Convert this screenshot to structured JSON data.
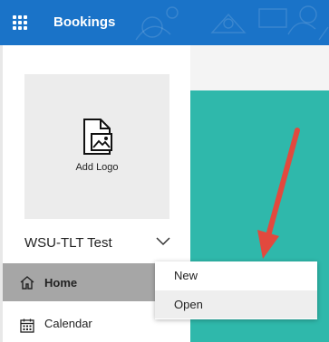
{
  "header": {
    "app_title": "Bookings",
    "menu_icon": "waffle-grid-icon",
    "accent": "#1a73c8"
  },
  "sidebar": {
    "logo": {
      "label": "Add Logo",
      "icon": "add-image-icon"
    },
    "business_name": "WSU-TLT Test",
    "toggle_icon": "chevron-down-icon",
    "nav": [
      {
        "label": "Home",
        "icon": "home-icon",
        "selected": true
      },
      {
        "label": "Calendar",
        "icon": "calendar-icon",
        "selected": false
      }
    ]
  },
  "dropdown": {
    "items": [
      {
        "label": "New",
        "highlighted": false
      },
      {
        "label": "Open",
        "highlighted": true
      }
    ]
  },
  "colors": {
    "content_teal": "#2fb8ab",
    "annotation_arrow": "#e2493e",
    "selected_nav": "#a6a6a6"
  }
}
